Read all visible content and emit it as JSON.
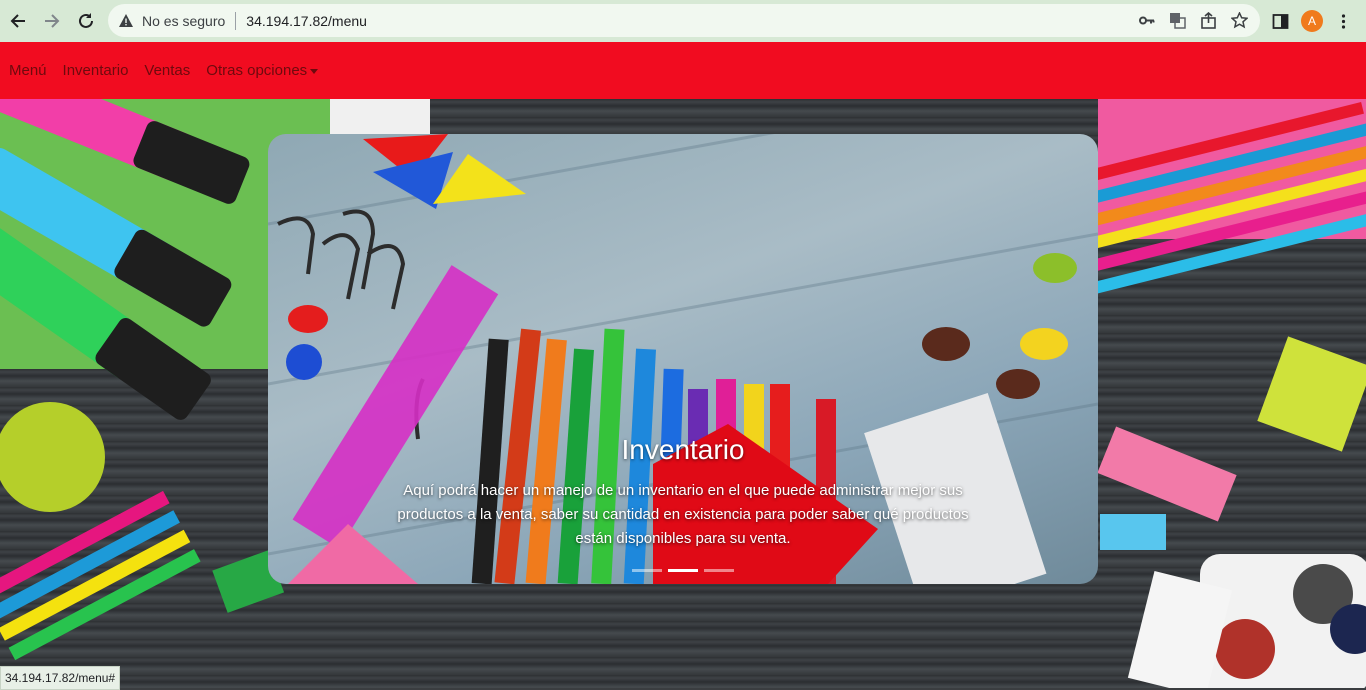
{
  "browser": {
    "security_label": "No es seguro",
    "url": "34.194.17.82/menu",
    "profile_initial": "A"
  },
  "navbar": {
    "items": [
      {
        "label": "Menú"
      },
      {
        "label": "Inventario"
      },
      {
        "label": "Ventas"
      },
      {
        "label": "Otras opciones"
      }
    ],
    "color": "#f10c20"
  },
  "carousel": {
    "title": "Inventario",
    "text": "Aquí podrá hacer un manejo de un inventario en el que puede administrar mejor sus productos a la venta, saber su cantidad en existencia para poder saber qué productos están disponibles para su venta.",
    "active_index": 1
  },
  "status_bar": {
    "text": "34.194.17.82/menu#"
  }
}
